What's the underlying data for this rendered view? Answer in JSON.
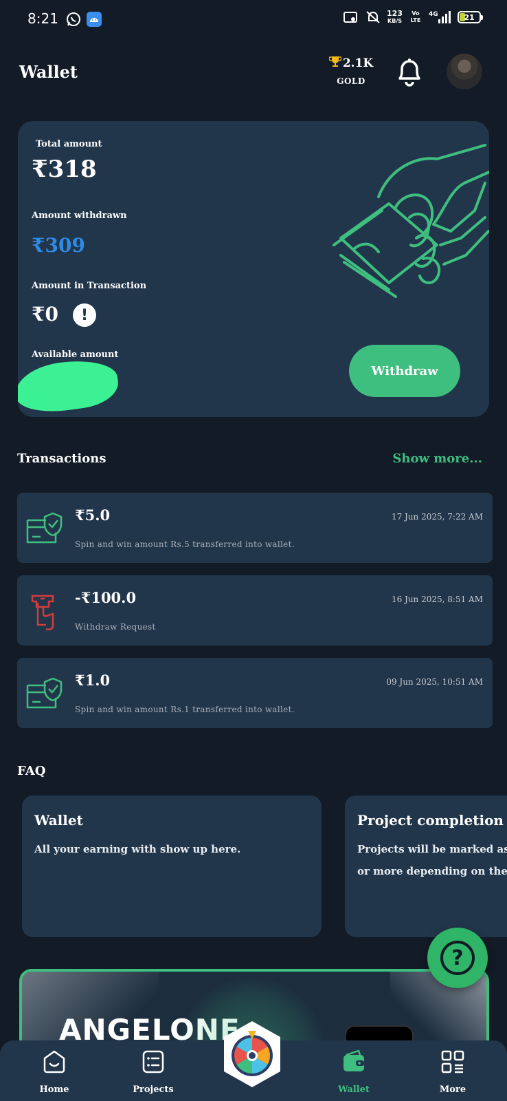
{
  "status_bar": {
    "time": "8:21",
    "network_speed_value": "123",
    "network_speed_unit": "KB/S",
    "volte": "Vo LTE",
    "signal": "4G",
    "battery": "21"
  },
  "header": {
    "title": "Wallet",
    "points": "2.1K",
    "tier": "GOLD"
  },
  "wallet": {
    "total_label": "Total amount",
    "total_value": "₹318",
    "withdrawn_label": "Amount withdrawn",
    "withdrawn_value": "₹309",
    "in_transaction_label": "Amount in Transaction",
    "in_transaction_value": "₹0",
    "available_label": "Available amount",
    "withdraw_button": "Withdraw"
  },
  "transactions": {
    "title": "Transactions",
    "show_more": "Show more...",
    "items": [
      {
        "amount": "₹5.0",
        "date": "17 Jun 2025, 7:22 AM",
        "description": "Spin and win amount Rs.5 transferred into wallet.",
        "kind": "credit"
      },
      {
        "amount": "-₹100.0",
        "date": "16 Jun 2025, 8:51 AM",
        "description": "Withdraw Request",
        "kind": "withdraw"
      },
      {
        "amount": "₹1.0",
        "date": "09 Jun 2025, 10:51 AM",
        "description": "Spin and win amount Rs.1 transferred into wallet.",
        "kind": "credit"
      }
    ]
  },
  "faq": {
    "title": "FAQ",
    "cards": [
      {
        "title": "Wallet",
        "body_line1": "All your earning with show up here.",
        "body_line2": ""
      },
      {
        "title": "Project completion",
        "body_line1": "Projects will be marked as",
        "body_line2": "or more depending on the"
      }
    ]
  },
  "banner": {
    "text": "ANGELONE"
  },
  "bottom_nav": {
    "items": [
      {
        "label": "Home",
        "icon": "home-icon"
      },
      {
        "label": "Projects",
        "icon": "projects-icon"
      },
      {
        "label": "Wallet",
        "icon": "wallet-icon"
      },
      {
        "label": "More",
        "icon": "more-grid-icon"
      }
    ],
    "active": "Wallet"
  },
  "colors": {
    "background": "#121b26",
    "card": "#22364b",
    "accent_green": "#3fbf7f",
    "withdrawn_blue": "#2f8be6",
    "withdraw_red": "#d23c3c"
  }
}
